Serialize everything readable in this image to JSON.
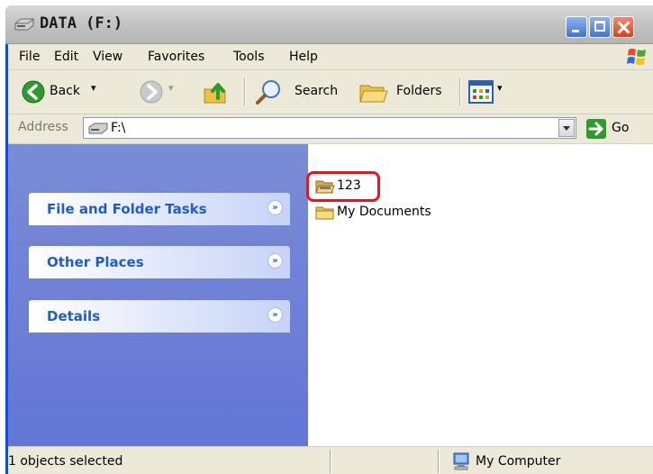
{
  "window": {
    "title": "DATA (F:)",
    "icon": "drive-icon"
  },
  "menu": {
    "items": [
      "File",
      "Edit",
      "View",
      "Favorites",
      "Tools",
      "Help"
    ]
  },
  "toolbar": {
    "back_label": "Back",
    "search_label": "Search",
    "folders_label": "Folders"
  },
  "address": {
    "label": "Address",
    "value": "F:\\",
    "go_label": "Go"
  },
  "tasks": {
    "panels": [
      "File and Folder Tasks",
      "Other Places",
      "Details"
    ]
  },
  "files": [
    {
      "name": "123",
      "icon": "open-folder-icon",
      "selected": true
    },
    {
      "name": "My Documents",
      "icon": "folder-icon",
      "selected": false
    }
  ],
  "status": {
    "text": "1 objects selected",
    "zone": "My Computer"
  },
  "colors": {
    "title_bar": "#c8c8c8",
    "task_pane": "#6f80d6",
    "task_title": "#215dc6",
    "highlight": "#e8141e"
  }
}
